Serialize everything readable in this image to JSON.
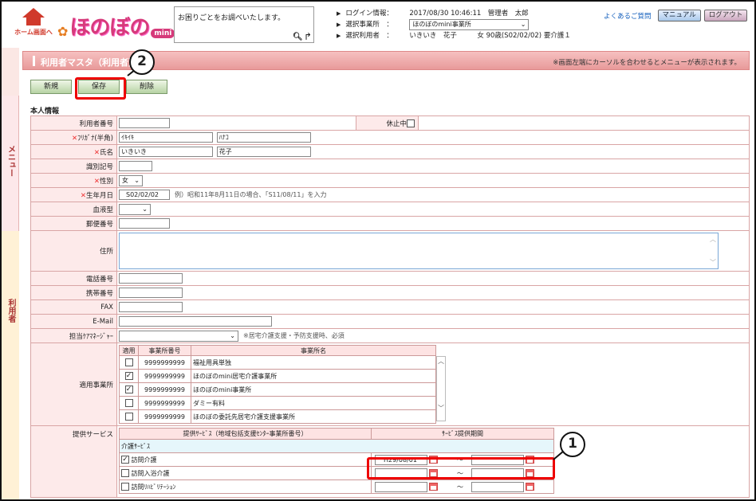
{
  "header": {
    "home_label": "ホーム画面へ",
    "logo_text": "ほのぼの",
    "logo_mini": "mini",
    "search_placeholder": "お困りごとをお調べいたします。",
    "info": {
      "login_label": "ログイン情報：",
      "login_value": "2017/08/30 10:46:11　管理者　太郎",
      "office_label": "選択事業所　：",
      "office_value": "ほのぼのmini事業所",
      "user_label": "選択利用者　：",
      "user_value": "いきいき　花子　　　女 90歳(S02/02/02) 要介護１"
    },
    "faq_link": "よくあるご質問",
    "manual_button": "マニュアル",
    "logout_button": "ログアウト"
  },
  "sidebar": {
    "menu_tab": "メニュー",
    "user_tab": "利用者"
  },
  "page": {
    "title": "利用者マスタ（利用者）",
    "note": "※画面左端にカーソルを合わせるとメニューが表示されます。",
    "buttons": {
      "new": "新規",
      "save": "保存",
      "delete": "削除"
    },
    "section_title": "本人情報"
  },
  "form": {
    "user_no_label": "利用者番号",
    "suspended_label": "休止中",
    "kana_label": "ﾌﾘｶﾞﾅ(半角)",
    "kana_last": "ｲｷｲｷ",
    "kana_first": "ﾊﾅｺ",
    "name_label": "氏名",
    "name_last": "いきいき",
    "name_first": "花子",
    "id_symbol_label": "識別記号",
    "sex_label": "性別",
    "sex_value": "女",
    "birth_label": "生年月日",
    "birth_value": "S02/02/02",
    "birth_hint": "例）昭和11年8月11日の場合、「S11/08/11」を入力",
    "blood_label": "血液型",
    "zip_label": "郵便番号",
    "address_label": "住所",
    "phone_label": "電話番号",
    "mobile_label": "携帯番号",
    "fax_label": "FAX",
    "email_label": "E-Mail",
    "care_manager_label": "担当ｹｱﾏﾈｰｼﾞｬｰ",
    "care_manager_hint": "※居宅介護支援・予防支援時、必須",
    "office_label": "適用事業所",
    "office_table": {
      "headers": [
        "適用",
        "事業所番号",
        "事業所名"
      ],
      "rows": [
        {
          "checked": false,
          "number": "9999999999",
          "name": "福祉用具単独"
        },
        {
          "checked": true,
          "number": "9999999999",
          "name": "ほのぼのmini居宅介護事業所"
        },
        {
          "checked": true,
          "number": "9999999999",
          "name": "ほのぼのmini事業所"
        },
        {
          "checked": false,
          "number": "9999999999",
          "name": "ダミー有料"
        },
        {
          "checked": false,
          "number": "9999999999",
          "name": "ほのぼの委託先居宅介護支援事業所"
        }
      ]
    },
    "service_label": "提供サービス",
    "service_table": {
      "headers": [
        "提供ｻｰﾋﾞｽ（地域包括支援ｾﾝﾀｰ事業所番号）",
        "ｻｰﾋﾞｽ提供期間"
      ],
      "group": "介護ｻｰﾋﾞｽ",
      "rows": [
        {
          "checked": true,
          "name": "訪問介護",
          "start": "H29/08/01",
          "end": ""
        },
        {
          "checked": false,
          "name": "訪問入浴介護",
          "start": "",
          "end": ""
        },
        {
          "checked": false,
          "name": "訪問ﾘﾊﾋﾞﾘﾃｰｼｮﾝ",
          "start": "",
          "end": ""
        }
      ],
      "tilde": "～"
    }
  },
  "callouts": {
    "one": "1",
    "two": "2"
  },
  "colors": {
    "accent": "#e89a9a",
    "callout": "#e00000"
  }
}
